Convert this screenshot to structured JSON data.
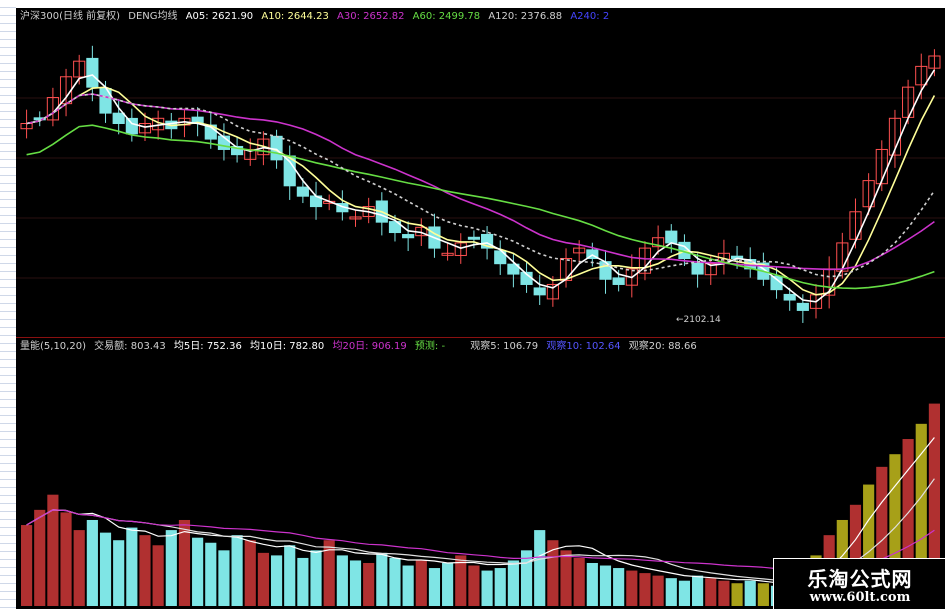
{
  "header_top": {
    "index_name": "沪深300(日线 前复权)",
    "indicator": "DENG均线",
    "a05": "A05: 2621.90",
    "a10": "A10: 2644.23",
    "a30": "A30: 2652.82",
    "a60": "A60: 2499.78",
    "a120": "A120: 2376.88",
    "a240": "A240: 2"
  },
  "header_bottom": {
    "indicator": "量能(5,10,20)",
    "volume": "交易额: 803.43",
    "ma5": "均5日: 752.36",
    "ma10": "均10日: 782.80",
    "ma20": "均20日: 906.19",
    "forecast": "预测: -",
    "obs5": "观察5: 106.79",
    "obs10": "观察10: 102.64",
    "obs20": "观察20: 88.66"
  },
  "annotation": {
    "low_label": "←2102.14"
  },
  "watermark": {
    "title": "乐淘公式网",
    "url": "www.60lt.com"
  },
  "colors": {
    "background": "#000000",
    "up": "#ff5050",
    "down": "#7fe5e5",
    "a05": "#ffffff",
    "a10": "#ffff99",
    "a30": "#cc33cc",
    "a60": "#66dd44",
    "volume_highlight": "#a7a018",
    "divider": "#8a1010"
  },
  "chart_data": [
    {
      "type": "candlestick",
      "title": "沪深300(日线 前复权)",
      "min_label": 2102.14,
      "series": [
        {
          "name": "A05",
          "last": 2621.9
        },
        {
          "name": "A10",
          "last": 2644.23
        },
        {
          "name": "A30",
          "last": 2652.82
        },
        {
          "name": "A60",
          "last": 2499.78
        },
        {
          "name": "A120",
          "last": 2376.88
        }
      ],
      "close_path": [
        2470,
        2480,
        2520,
        2560,
        2590,
        2540,
        2490,
        2470,
        2450,
        2470,
        2480,
        2460,
        2480,
        2470,
        2440,
        2420,
        2410,
        2420,
        2440,
        2400,
        2350,
        2330,
        2310,
        2320,
        2300,
        2290,
        2310,
        2280,
        2260,
        2250,
        2270,
        2230,
        2220,
        2240,
        2250,
        2230,
        2200,
        2180,
        2160,
        2140,
        2160,
        2210,
        2230,
        2210,
        2170,
        2160,
        2190,
        2230,
        2250,
        2240,
        2210,
        2180,
        2200,
        2220,
        2210,
        2190,
        2170,
        2150,
        2130,
        2110,
        2140,
        2190,
        2240,
        2300,
        2360,
        2420,
        2480,
        2540,
        2580,
        2600
      ],
      "ylim": [
        2080,
        2600
      ]
    },
    {
      "type": "bar",
      "title": "量能(5,10,20)",
      "series": [
        {
          "name": "交易额",
          "last": 803.43
        },
        {
          "name": "均5日",
          "last": 752.36
        },
        {
          "name": "均10日",
          "last": 782.8
        },
        {
          "name": "均20日",
          "last": 906.19
        }
      ],
      "values": [
        0.32,
        0.38,
        0.44,
        0.37,
        0.3,
        0.34,
        0.29,
        0.26,
        0.31,
        0.28,
        0.24,
        0.3,
        0.34,
        0.27,
        0.25,
        0.22,
        0.28,
        0.26,
        0.21,
        0.2,
        0.24,
        0.19,
        0.22,
        0.26,
        0.2,
        0.18,
        0.17,
        0.21,
        0.19,
        0.16,
        0.18,
        0.15,
        0.17,
        0.2,
        0.16,
        0.14,
        0.15,
        0.18,
        0.22,
        0.3,
        0.26,
        0.22,
        0.19,
        0.17,
        0.16,
        0.15,
        0.14,
        0.13,
        0.12,
        0.11,
        0.1,
        0.12,
        0.11,
        0.1,
        0.09,
        0.1,
        0.09,
        0.08,
        0.08,
        0.09,
        0.2,
        0.28,
        0.34,
        0.4,
        0.48,
        0.55,
        0.6,
        0.66,
        0.72,
        0.8
      ],
      "ylim": [
        0,
        1
      ]
    }
  ]
}
